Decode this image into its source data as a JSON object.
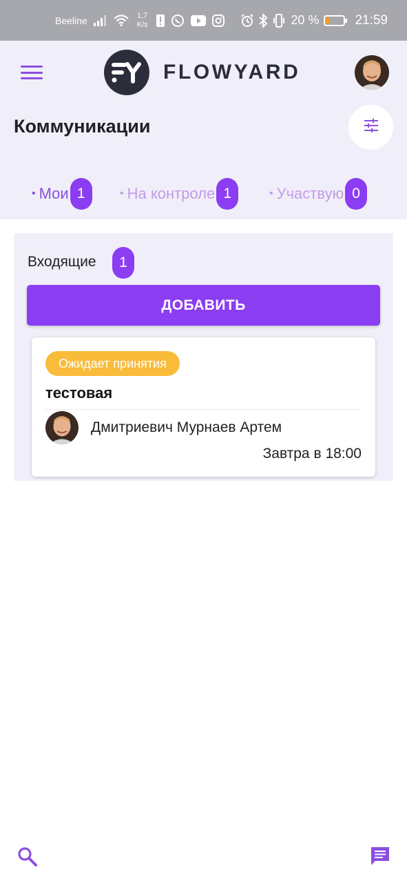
{
  "status_bar": {
    "carrier": "Beeline",
    "net_speed_value": "1,7",
    "net_speed_unit": "K/s",
    "battery_percent": "20 %",
    "time": "21:59",
    "icons": [
      "signal-icon",
      "wifi-icon",
      "notification-icon",
      "whatsapp-icon",
      "youtube-icon",
      "instagram-icon",
      "alarm-icon",
      "bluetooth-icon",
      "vibrate-icon",
      "battery-icon"
    ]
  },
  "header": {
    "brand": "FLOWYARD",
    "page_title": "Коммуникации"
  },
  "tabs": [
    {
      "label": "Мои",
      "count": "1",
      "active": true
    },
    {
      "label": "На контроле",
      "count": "1",
      "active": false
    },
    {
      "label": "Участвую",
      "count": "0",
      "active": false
    }
  ],
  "inbox": {
    "title": "Входящие",
    "count": "1",
    "add_label": "ДОБАВИТЬ"
  },
  "cards": [
    {
      "status": "Ожидает принятия",
      "title": "тестовая",
      "person": "Дмитриевич Мурнаев Артем",
      "due": "Завтра в 18:00"
    }
  ],
  "colors": {
    "accent": "#8b3df2",
    "accent_light": "#c29be8",
    "header_bg": "#f0eff9",
    "status_chip": "#f9bb3a",
    "logo_dark": "#2b2d3a"
  },
  "bottom_nav": {
    "icons": [
      "search-icon",
      "chat-icon"
    ]
  }
}
